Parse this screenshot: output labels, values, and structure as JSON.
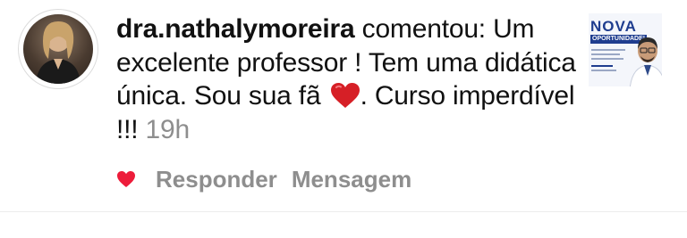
{
  "comment": {
    "username": "dra.nathalymoreira",
    "text_before_emoji": " comentou: Um excelente professor ! Tem uma didática única. Sou sua fã ",
    "emoji": "red-heart-emoji",
    "text_after_emoji": ". Curso imperdível !!! ",
    "time": "19h"
  },
  "actions": {
    "like_icon": "heart-icon",
    "reply_label": "Responder",
    "message_label": "Mensagem"
  },
  "thumbnail": {
    "title": "NOVA",
    "subtitle": "OPORTUNIDADE!"
  },
  "colors": {
    "like_heart": "#ed1c3a",
    "emoji_heart": "#d61f26",
    "muted_text": "#8e8e8e",
    "text": "#111111",
    "thumbnail_accent": "#1f3d8f"
  }
}
